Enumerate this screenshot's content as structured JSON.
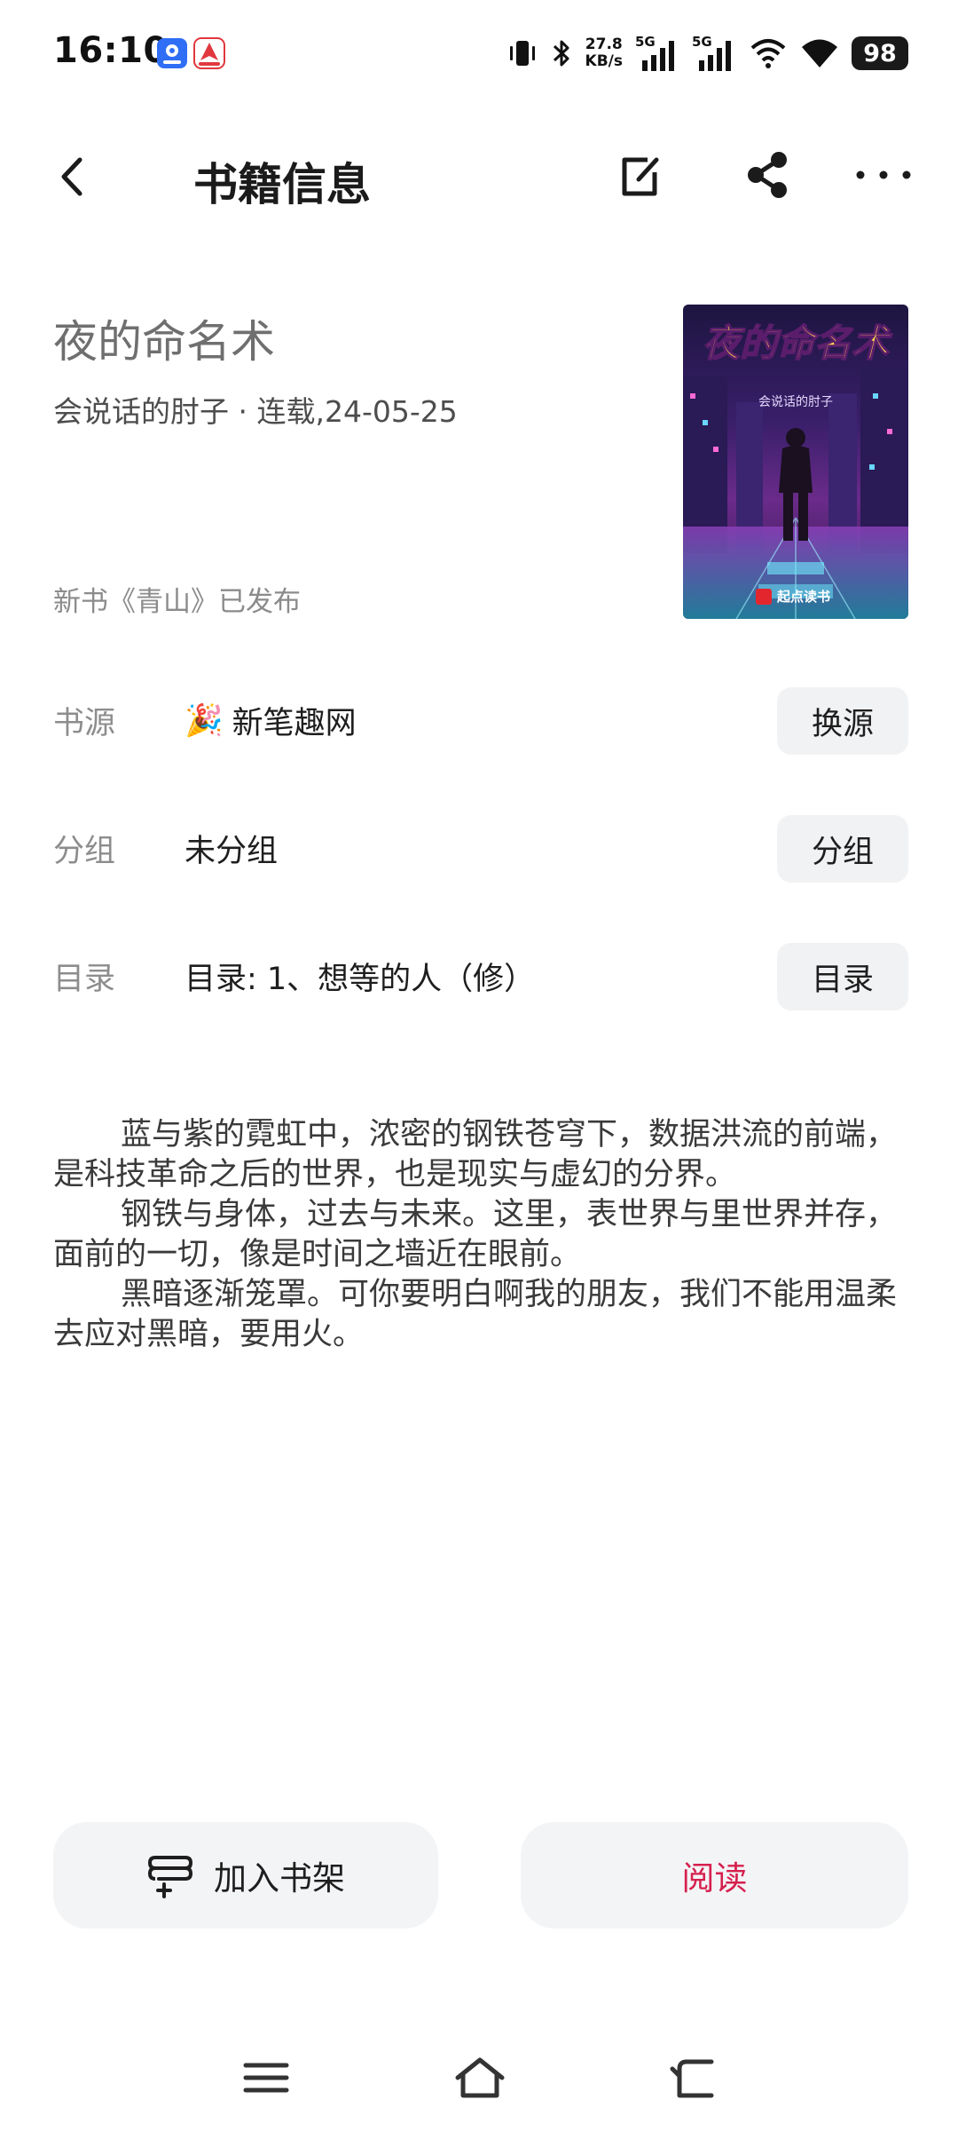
{
  "status_bar": {
    "time": "16:10",
    "net_speed_value": "27.8",
    "net_speed_unit": "KB/s",
    "net1_label": "5G",
    "net2_label": "5G",
    "battery": "98"
  },
  "header": {
    "title": "书籍信息",
    "icons": [
      "back-arrow-icon",
      "edit-icon",
      "share-icon",
      "more-icon"
    ]
  },
  "book": {
    "title": "夜的命名术",
    "meta": "会说话的肘子 · 连载,24-05-25",
    "notice": "新书《青山》已发布",
    "cover_title": "夜的命名术",
    "cover_author": "会说话的肘子",
    "cover_publisher": "起点读书"
  },
  "rows": {
    "source": {
      "label": "书源",
      "emoji": "🎉",
      "value": "新笔趣网",
      "button": "换源"
    },
    "group": {
      "label": "分组",
      "value": "未分组",
      "button": "分组"
    },
    "toc": {
      "label": "目录",
      "value": "目录: 1、想等的人（修）",
      "button": "目录"
    }
  },
  "intro": [
    "蓝与紫的霓虹中，浓密的钢铁苍穹下，数据洪流的前端，是科技革命之后的世界，也是现实与虚幻的分界。",
    "钢铁与身体，过去与未来。这里，表世界与里世界并存，面前的一切，像是时间之墙近在眼前。",
    "黑暗逐渐笼罩。可你要明白啊我的朋友，我们不能用温柔去应对黑暗，要用火。"
  ],
  "actions": {
    "add_to_shelf": "加入书架",
    "read": "阅读"
  },
  "colors": {
    "accent": "#d6204e",
    "button_bg": "#f1f2f4",
    "label_gray": "#8d8d8d"
  }
}
